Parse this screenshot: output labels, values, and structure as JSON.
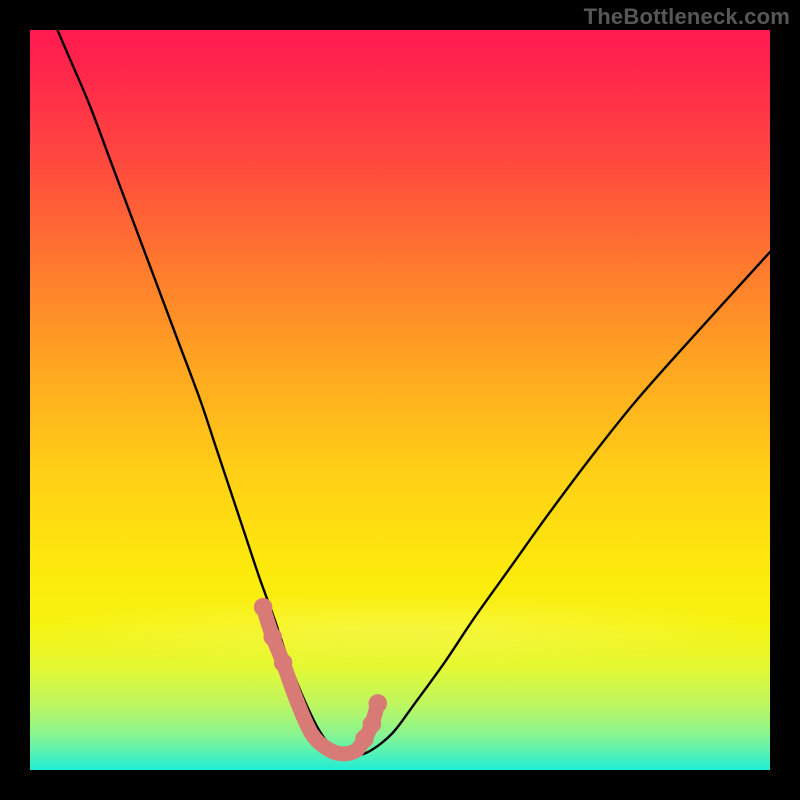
{
  "watermark": "TheBottleneck.com",
  "colors": {
    "gradient_top": "#ff1a4f",
    "gradient_bottom": "#1feed6",
    "curve": "#000000",
    "markers": "#d87a76",
    "frame": "#000000"
  },
  "chart_data": {
    "type": "line",
    "title": "",
    "xlabel": "",
    "ylabel": "",
    "xlim": [
      0,
      100
    ],
    "ylim": [
      0,
      100
    ],
    "grid": false,
    "legend": false,
    "series": [
      {
        "name": "bottleneck-curve",
        "x": [
          2,
          5,
          8,
          11,
          14,
          17,
          20,
          23,
          25,
          27,
          29,
          31,
          33,
          34.5,
          36,
          37.5,
          39,
          40.5,
          42,
          44,
          46,
          49,
          52,
          56,
          60,
          65,
          70,
          76,
          82,
          90,
          100
        ],
        "y": [
          104,
          97,
          90,
          82,
          74,
          66,
          58,
          50,
          44,
          38,
          32,
          26,
          20.5,
          16,
          12,
          8.5,
          5.5,
          3.4,
          2.2,
          2.0,
          2.6,
          5,
          9,
          14.5,
          20.5,
          27.5,
          34.5,
          42.5,
          50,
          59,
          70
        ]
      }
    ],
    "optimum_markers": {
      "x": [
        31.5,
        32.8,
        34.2,
        36,
        38,
        40,
        42,
        44,
        45.2,
        46.2,
        47
      ],
      "y": [
        22,
        18,
        14.5,
        9.5,
        5,
        3,
        2.2,
        2.6,
        4.2,
        6.2,
        9
      ]
    }
  }
}
